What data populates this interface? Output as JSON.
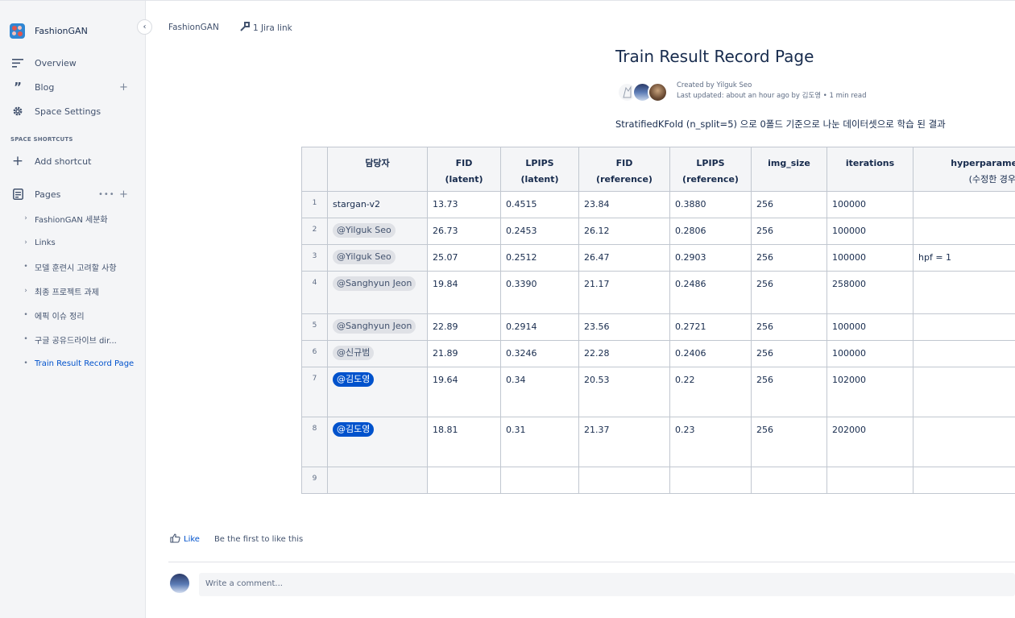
{
  "sidebar": {
    "space_name": "FashionGAN",
    "nav": [
      {
        "label": "Overview",
        "icon": "overview-icon"
      },
      {
        "label": "Blog",
        "icon": "quote-icon"
      },
      {
        "label": "Space Settings",
        "icon": "gear-icon"
      }
    ],
    "shortcuts_heading": "SPACE SHORTCUTS",
    "add_shortcut": "Add shortcut",
    "pages_label": "Pages",
    "tree": [
      {
        "label": "FashionGAN 세분화",
        "marker": "chevron-right"
      },
      {
        "label": "Links",
        "marker": "chevron-right"
      },
      {
        "label": "모델 훈련시 고려할 사항",
        "marker": "bullet"
      },
      {
        "label": "최종 프로젝트 과제",
        "marker": "chevron-right"
      },
      {
        "label": "에픽 이슈 정리",
        "marker": "bullet"
      },
      {
        "label": "구글 공유드라이브 dir...",
        "marker": "bullet"
      },
      {
        "label": "Train Result Record Page",
        "marker": "bullet",
        "active": true
      }
    ]
  },
  "topbar": {
    "breadcrumb": "FashionGAN",
    "jira_link": "1 Jira link"
  },
  "page": {
    "title": "Train Result Record Page",
    "created_by": "Created by Yilguk Seo",
    "last_updated": "Last updated: about an hour ago by 김도영 •  1 min read",
    "description": "StratifiedKFold (n_split=5) 으로 0폴드 기준으로 나눈 데이터셋으로 학습 된 결과"
  },
  "table": {
    "headers": [
      {
        "line1": "",
        "line2": ""
      },
      {
        "line1": "담당자",
        "line2": ""
      },
      {
        "line1": "FID",
        "line2": "(latent)"
      },
      {
        "line1": "LPIPS",
        "line2": "(latent)"
      },
      {
        "line1": "FID",
        "line2": "(reference)"
      },
      {
        "line1": "LPIPS",
        "line2": "(reference)"
      },
      {
        "line1": "img_size",
        "line2": ""
      },
      {
        "line1": "iterations",
        "line2": ""
      },
      {
        "line1": "hyperparameters",
        "line2": "(수정한 경우)"
      }
    ],
    "rows": [
      {
        "n": "1",
        "owner": "stargan-v2",
        "owner_type": "plain",
        "fid_latent": "13.73",
        "lpips_latent": "0.4515",
        "fid_ref": "23.84",
        "lpips_ref": "0.3880",
        "img_size": "256",
        "iterations": "100000",
        "hyper": "",
        "tall": false
      },
      {
        "n": "2",
        "owner": "@Yilguk Seo",
        "owner_type": "mention",
        "fid_latent": "26.73",
        "lpips_latent": "0.2453",
        "fid_ref": "26.12",
        "lpips_ref": "0.2806",
        "img_size": "256",
        "iterations": "100000",
        "hyper": "",
        "tall": false
      },
      {
        "n": "3",
        "owner": "@Yilguk Seo",
        "owner_type": "mention",
        "fid_latent": "25.07",
        "lpips_latent": "0.2512",
        "fid_ref": "26.47",
        "lpips_ref": "0.2903",
        "img_size": "256",
        "iterations": "100000",
        "hyper": "hpf = 1",
        "tall": false
      },
      {
        "n": "4",
        "owner": "@Sanghyun Jeon",
        "owner_type": "mention",
        "fid_latent": "19.84",
        "lpips_latent": "0.3390",
        "fid_ref": "21.17",
        "lpips_ref": "0.2486",
        "img_size": "256",
        "iterations": "258000",
        "hyper": "",
        "tall": "mid"
      },
      {
        "n": "5",
        "owner": "@Sanghyun Jeon",
        "owner_type": "mention",
        "fid_latent": "22.89",
        "lpips_latent": "0.2914",
        "fid_ref": "23.56",
        "lpips_ref": "0.2721",
        "img_size": "256",
        "iterations": "100000",
        "hyper": "",
        "tall": false
      },
      {
        "n": "6",
        "owner": "@신규범",
        "owner_type": "mention",
        "fid_latent": "21.89",
        "lpips_latent": "0.3246",
        "fid_ref": "22.28",
        "lpips_ref": "0.2406",
        "img_size": "256",
        "iterations": "100000",
        "hyper": "",
        "tall": false
      },
      {
        "n": "7",
        "owner": "@김도영",
        "owner_type": "self",
        "fid_latent": "19.64",
        "lpips_latent": "0.34",
        "fid_ref": "20.53",
        "lpips_ref": "0.22",
        "img_size": "256",
        "iterations": "102000",
        "hyper": "",
        "tall": "big"
      },
      {
        "n": "8",
        "owner": "@김도영",
        "owner_type": "self",
        "fid_latent": "18.81",
        "lpips_latent": "0.31",
        "fid_ref": "21.37",
        "lpips_ref": "0.23",
        "img_size": "256",
        "iterations": "202000",
        "hyper": "",
        "tall": "big"
      },
      {
        "n": "9",
        "owner": "",
        "owner_type": "plain",
        "fid_latent": "",
        "lpips_latent": "",
        "fid_ref": "",
        "lpips_ref": "",
        "img_size": "",
        "iterations": "",
        "hyper": "",
        "tall": false
      }
    ]
  },
  "footer": {
    "like_label": "Like",
    "like_hint": "Be the first to like this",
    "comment_placeholder": "Write a comment..."
  },
  "colors": {
    "accent": "#0052cc",
    "sidebar_bg": "#f4f5f7",
    "mention_bg": "#dfe1e6"
  }
}
